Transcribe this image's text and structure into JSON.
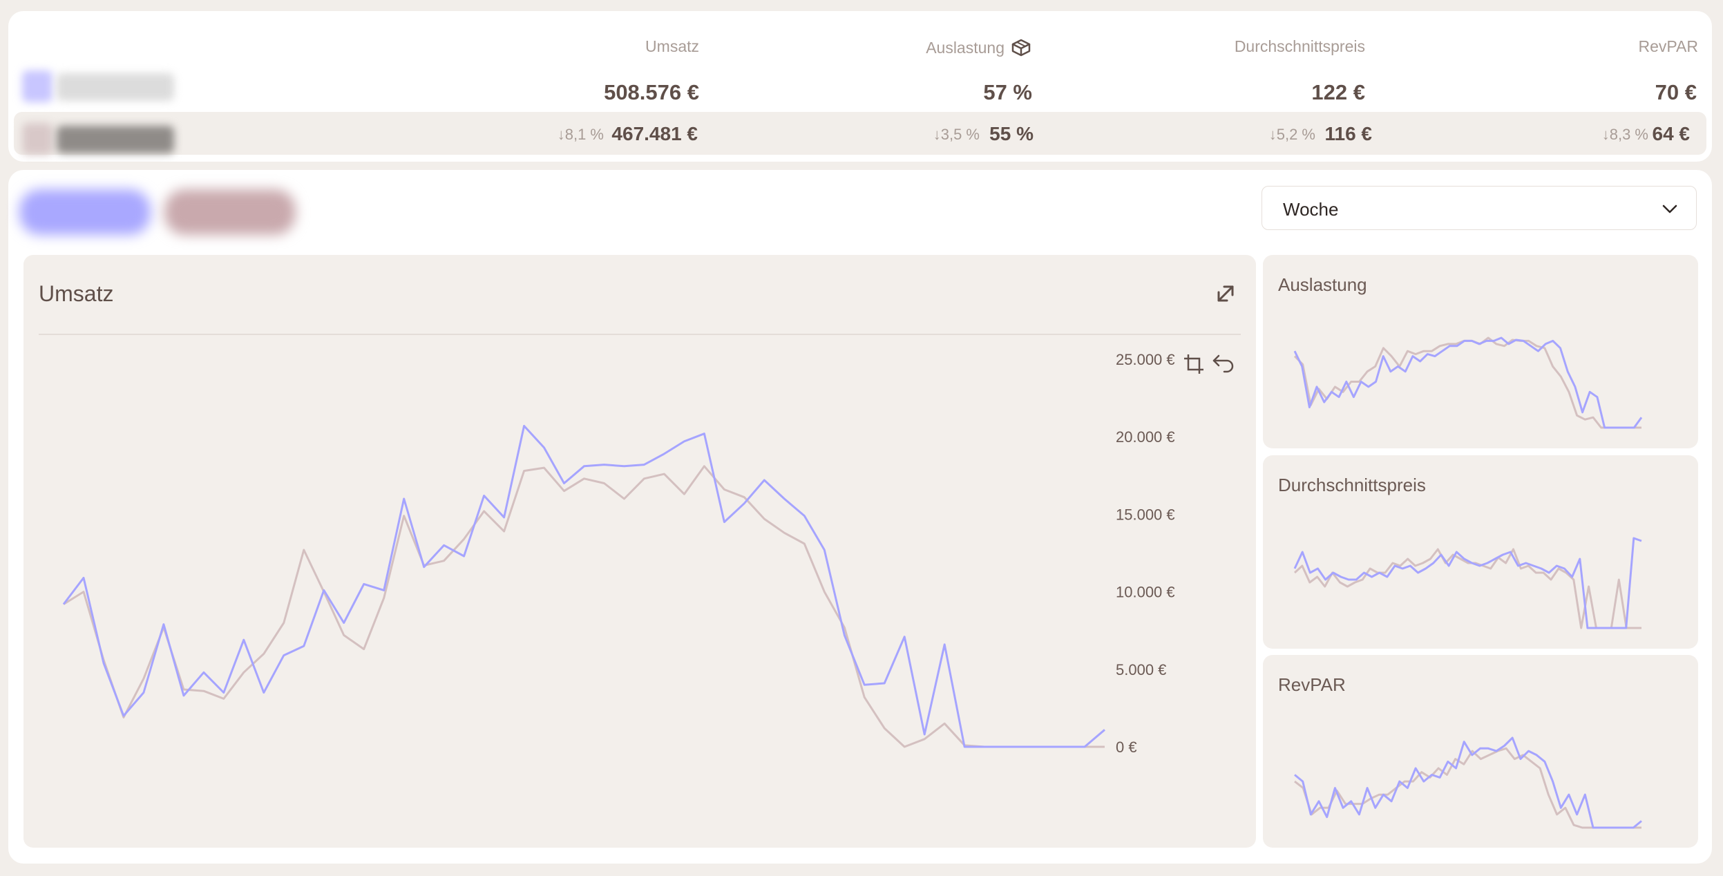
{
  "colors": {
    "current_series": "#a5a4ff",
    "previous_series": "#d4c0c0",
    "text_primary": "#5f4f49",
    "text_muted": "#a89c96",
    "panel_bg": "#f3efeb"
  },
  "summary": {
    "columns": [
      {
        "label": "Umsatz",
        "value": "508.576 €",
        "previous_value": "467.481 €",
        "change": "8,1 %",
        "change_direction": "down"
      },
      {
        "label": "Auslastung",
        "value": "57 %",
        "previous_value": "55 %",
        "change": "3,5 %",
        "change_direction": "down",
        "icon": "box-icon"
      },
      {
        "label": "Durchschnittspreis",
        "value": "122 €",
        "previous_value": "116 €",
        "change": "5,2 %",
        "change_direction": "down"
      },
      {
        "label": "RevPAR",
        "value": "70 €",
        "previous_value": "64 €",
        "change": "8,3 %",
        "change_direction": "down"
      }
    ]
  },
  "period_select": {
    "selected": "Woche",
    "icon": "chevron-down-icon"
  },
  "main_chart": {
    "title": "Umsatz",
    "icons": [
      "expand-icon",
      "crop-icon",
      "undo-icon"
    ]
  },
  "side_charts": [
    {
      "title": "Auslastung"
    },
    {
      "title": "Durchschnittspreis"
    },
    {
      "title": "RevPAR"
    }
  ],
  "chart_data": [
    {
      "type": "line",
      "title": "Umsatz",
      "y_ticks": [
        "25.000 €",
        "20.000 €",
        "15.000 €",
        "10.000 €",
        "5.000 €",
        "0 €"
      ],
      "ylim": [
        0,
        25000
      ],
      "series": [
        {
          "values": [
            9200,
            10900,
            5400,
            2000,
            3500,
            7900,
            3300,
            4800,
            3500,
            6900,
            3500,
            5900,
            6500,
            10100,
            8000,
            10500,
            10100,
            16000,
            11600,
            13000,
            12300,
            16200,
            14800,
            20700,
            19300,
            17000,
            18100,
            18200,
            18100,
            18200,
            18900,
            19700,
            20200,
            14500,
            15700,
            17200,
            16000,
            14900,
            12700,
            7200,
            4000,
            4100,
            7100,
            800,
            6600,
            0,
            0,
            0,
            0,
            0,
            0,
            0,
            1100
          ]
        },
        {
          "values": [
            9200,
            10000,
            5600,
            1900,
            4400,
            7700,
            3700,
            3600,
            3100,
            4800,
            6000,
            8000,
            12700,
            10000,
            7200,
            6300,
            9600,
            14900,
            11700,
            12000,
            13400,
            15200,
            13900,
            17800,
            18000,
            16500,
            17300,
            17000,
            16000,
            17300,
            17600,
            16300,
            18100,
            16600,
            16100,
            14700,
            13800,
            13100,
            10000,
            7700,
            3200,
            1200,
            0,
            500,
            1500,
            100,
            0,
            0,
            0,
            0,
            0,
            0,
            0
          ]
        }
      ]
    },
    {
      "type": "line",
      "title": "Auslastung",
      "series": [
        {
          "values": [
            75,
            60,
            20,
            40,
            25,
            35,
            30,
            45,
            30,
            45,
            40,
            45,
            70,
            55,
            60,
            55,
            70,
            65,
            72,
            70,
            75,
            80,
            80,
            85,
            85,
            82,
            85,
            85,
            88,
            82,
            86,
            85,
            80,
            75,
            82,
            85,
            78,
            55,
            40,
            15,
            35,
            30,
            0,
            0,
            0,
            0,
            0,
            10
          ]
        },
        {
          "values": [
            70,
            62,
            22,
            38,
            28,
            40,
            35,
            45,
            45,
            55,
            60,
            78,
            70,
            60,
            75,
            72,
            75,
            75,
            80,
            82,
            82,
            85,
            85,
            82,
            88,
            82,
            80,
            86,
            85,
            85,
            80,
            78,
            60,
            50,
            35,
            12,
            8,
            10,
            0,
            0,
            0,
            0,
            0,
            0
          ]
        }
      ]
    },
    {
      "type": "line",
      "title": "Durchschnittspreis",
      "series": [
        {
          "values": [
            58,
            70,
            55,
            58,
            50,
            55,
            52,
            50,
            50,
            55,
            52,
            55,
            52,
            60,
            58,
            60,
            55,
            58,
            62,
            68,
            60,
            70,
            65,
            62,
            60,
            62,
            65,
            68,
            70,
            60,
            62,
            60,
            58,
            55,
            60,
            58,
            52,
            65,
            15,
            15,
            15,
            15,
            15,
            15,
            80,
            78
          ]
        },
        {
          "values": [
            55,
            60,
            48,
            52,
            45,
            55,
            48,
            45,
            48,
            50,
            58,
            55,
            55,
            62,
            60,
            65,
            60,
            62,
            65,
            72,
            62,
            68,
            65,
            62,
            62,
            60,
            58,
            66,
            62,
            72,
            58,
            60,
            55,
            55,
            50,
            58,
            55,
            50,
            15,
            45,
            15,
            15,
            15,
            50,
            15,
            15,
            15
          ]
        }
      ]
    },
    {
      "type": "line",
      "title": "RevPAR",
      "series": [
        {
          "values": [
            50,
            45,
            20,
            30,
            18,
            40,
            25,
            30,
            20,
            40,
            25,
            35,
            30,
            45,
            40,
            55,
            45,
            50,
            48,
            60,
            55,
            75,
            65,
            70,
            70,
            68,
            72,
            78,
            62,
            68,
            65,
            60,
            45,
            25,
            35,
            20,
            35,
            10,
            10,
            10,
            10,
            10,
            10,
            15
          ]
        },
        {
          "values": [
            45,
            40,
            20,
            25,
            25,
            38,
            28,
            28,
            28,
            32,
            35,
            35,
            40,
            45,
            45,
            52,
            48,
            55,
            50,
            62,
            58,
            68,
            62,
            65,
            68,
            70,
            62,
            65,
            60,
            55,
            35,
            20,
            25,
            12,
            10,
            10,
            10,
            10,
            10,
            10,
            10,
            10
          ]
        }
      ]
    }
  ]
}
